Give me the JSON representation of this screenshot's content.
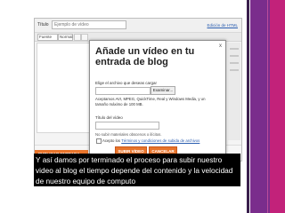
{
  "editor": {
    "title_label": "Título",
    "title_placeholder": "Ejemplo de vídeo",
    "edit_html": "Edición de HTML",
    "font": "Fuente",
    "size": "Normal",
    "publish": "PUBLICAR ENTRADA"
  },
  "dialog": {
    "title": "Añade un vídeo en tu entrada de blog",
    "choose_file": "Elige el archivo que deseas cargar",
    "browse": "Examinar...",
    "formats": "Aceptamos AVI, MPEG, QuickTime, Real y Windows Media, y un tamaño máximo de 100 MB.",
    "video_title": "Título del vídeo",
    "note": "No subir materiales obscenos o ilícitos.",
    "accept_prefix": "Acepto los",
    "accept_link": "Términos y condiciones de subida de archivos",
    "upload": "SUBIR VÍDEO",
    "cancel": "CANCELAR",
    "close": "x"
  },
  "caption": "Y así damos por terminado el proceso para subir nuestro video al blog el tiempo depende del contenido y la velocidad de nuestro equipo de computo",
  "colors": {
    "accent_orange": "#e8742b",
    "bar_purple": "#7a2d8c",
    "bar_magenta": "#c2227a"
  }
}
